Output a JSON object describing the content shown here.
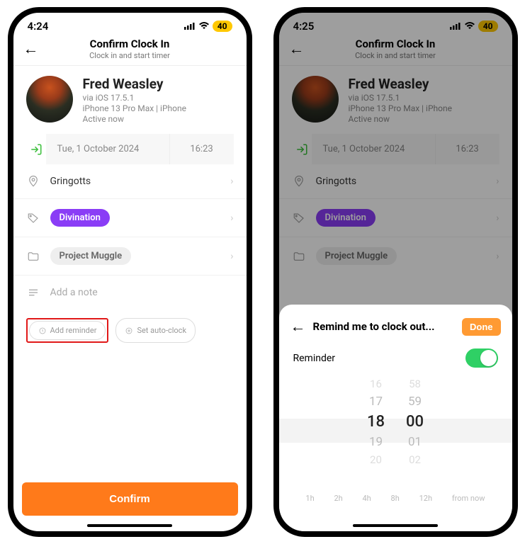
{
  "left": {
    "status": {
      "time": "4:24",
      "battery": "40"
    },
    "header": {
      "title": "Confirm Clock In",
      "subtitle": "Clock in and start timer"
    },
    "profile": {
      "name": "Fred Weasley",
      "via": "via iOS 17.5.1",
      "device": "iPhone 13 Pro Max | iPhone",
      "status": "Active now"
    },
    "datetime": {
      "date": "Tue, 1 October 2024",
      "time": "16:23"
    },
    "location": "Gringotts",
    "tag": "Divination",
    "project": "Project Muggle",
    "note_placeholder": "Add a note",
    "add_reminder": "Add reminder",
    "set_autoclock": "Set auto-clock",
    "confirm": "Confirm"
  },
  "right": {
    "status": {
      "time": "4:25",
      "battery": "40"
    },
    "header": {
      "title": "Confirm Clock In",
      "subtitle": "Clock in and start timer"
    },
    "profile": {
      "name": "Fred Weasley",
      "via": "via iOS 17.5.1",
      "device": "iPhone 13 Pro Max | iPhone",
      "status": "Active now"
    },
    "datetime": {
      "date": "Tue, 1 October 2024",
      "time": "16:23"
    },
    "location": "Gringotts",
    "tag": "Divination",
    "project": "Project Muggle",
    "sheet": {
      "title": "Remind me to clock out...",
      "done": "Done",
      "reminder_label": "Reminder",
      "picker_hours": [
        "16",
        "17",
        "18",
        "19",
        "20"
      ],
      "picker_minutes": [
        "58",
        "59",
        "00",
        "01",
        "02"
      ],
      "quick": [
        "1h",
        "2h",
        "4h",
        "8h",
        "12h",
        "from now"
      ]
    }
  }
}
